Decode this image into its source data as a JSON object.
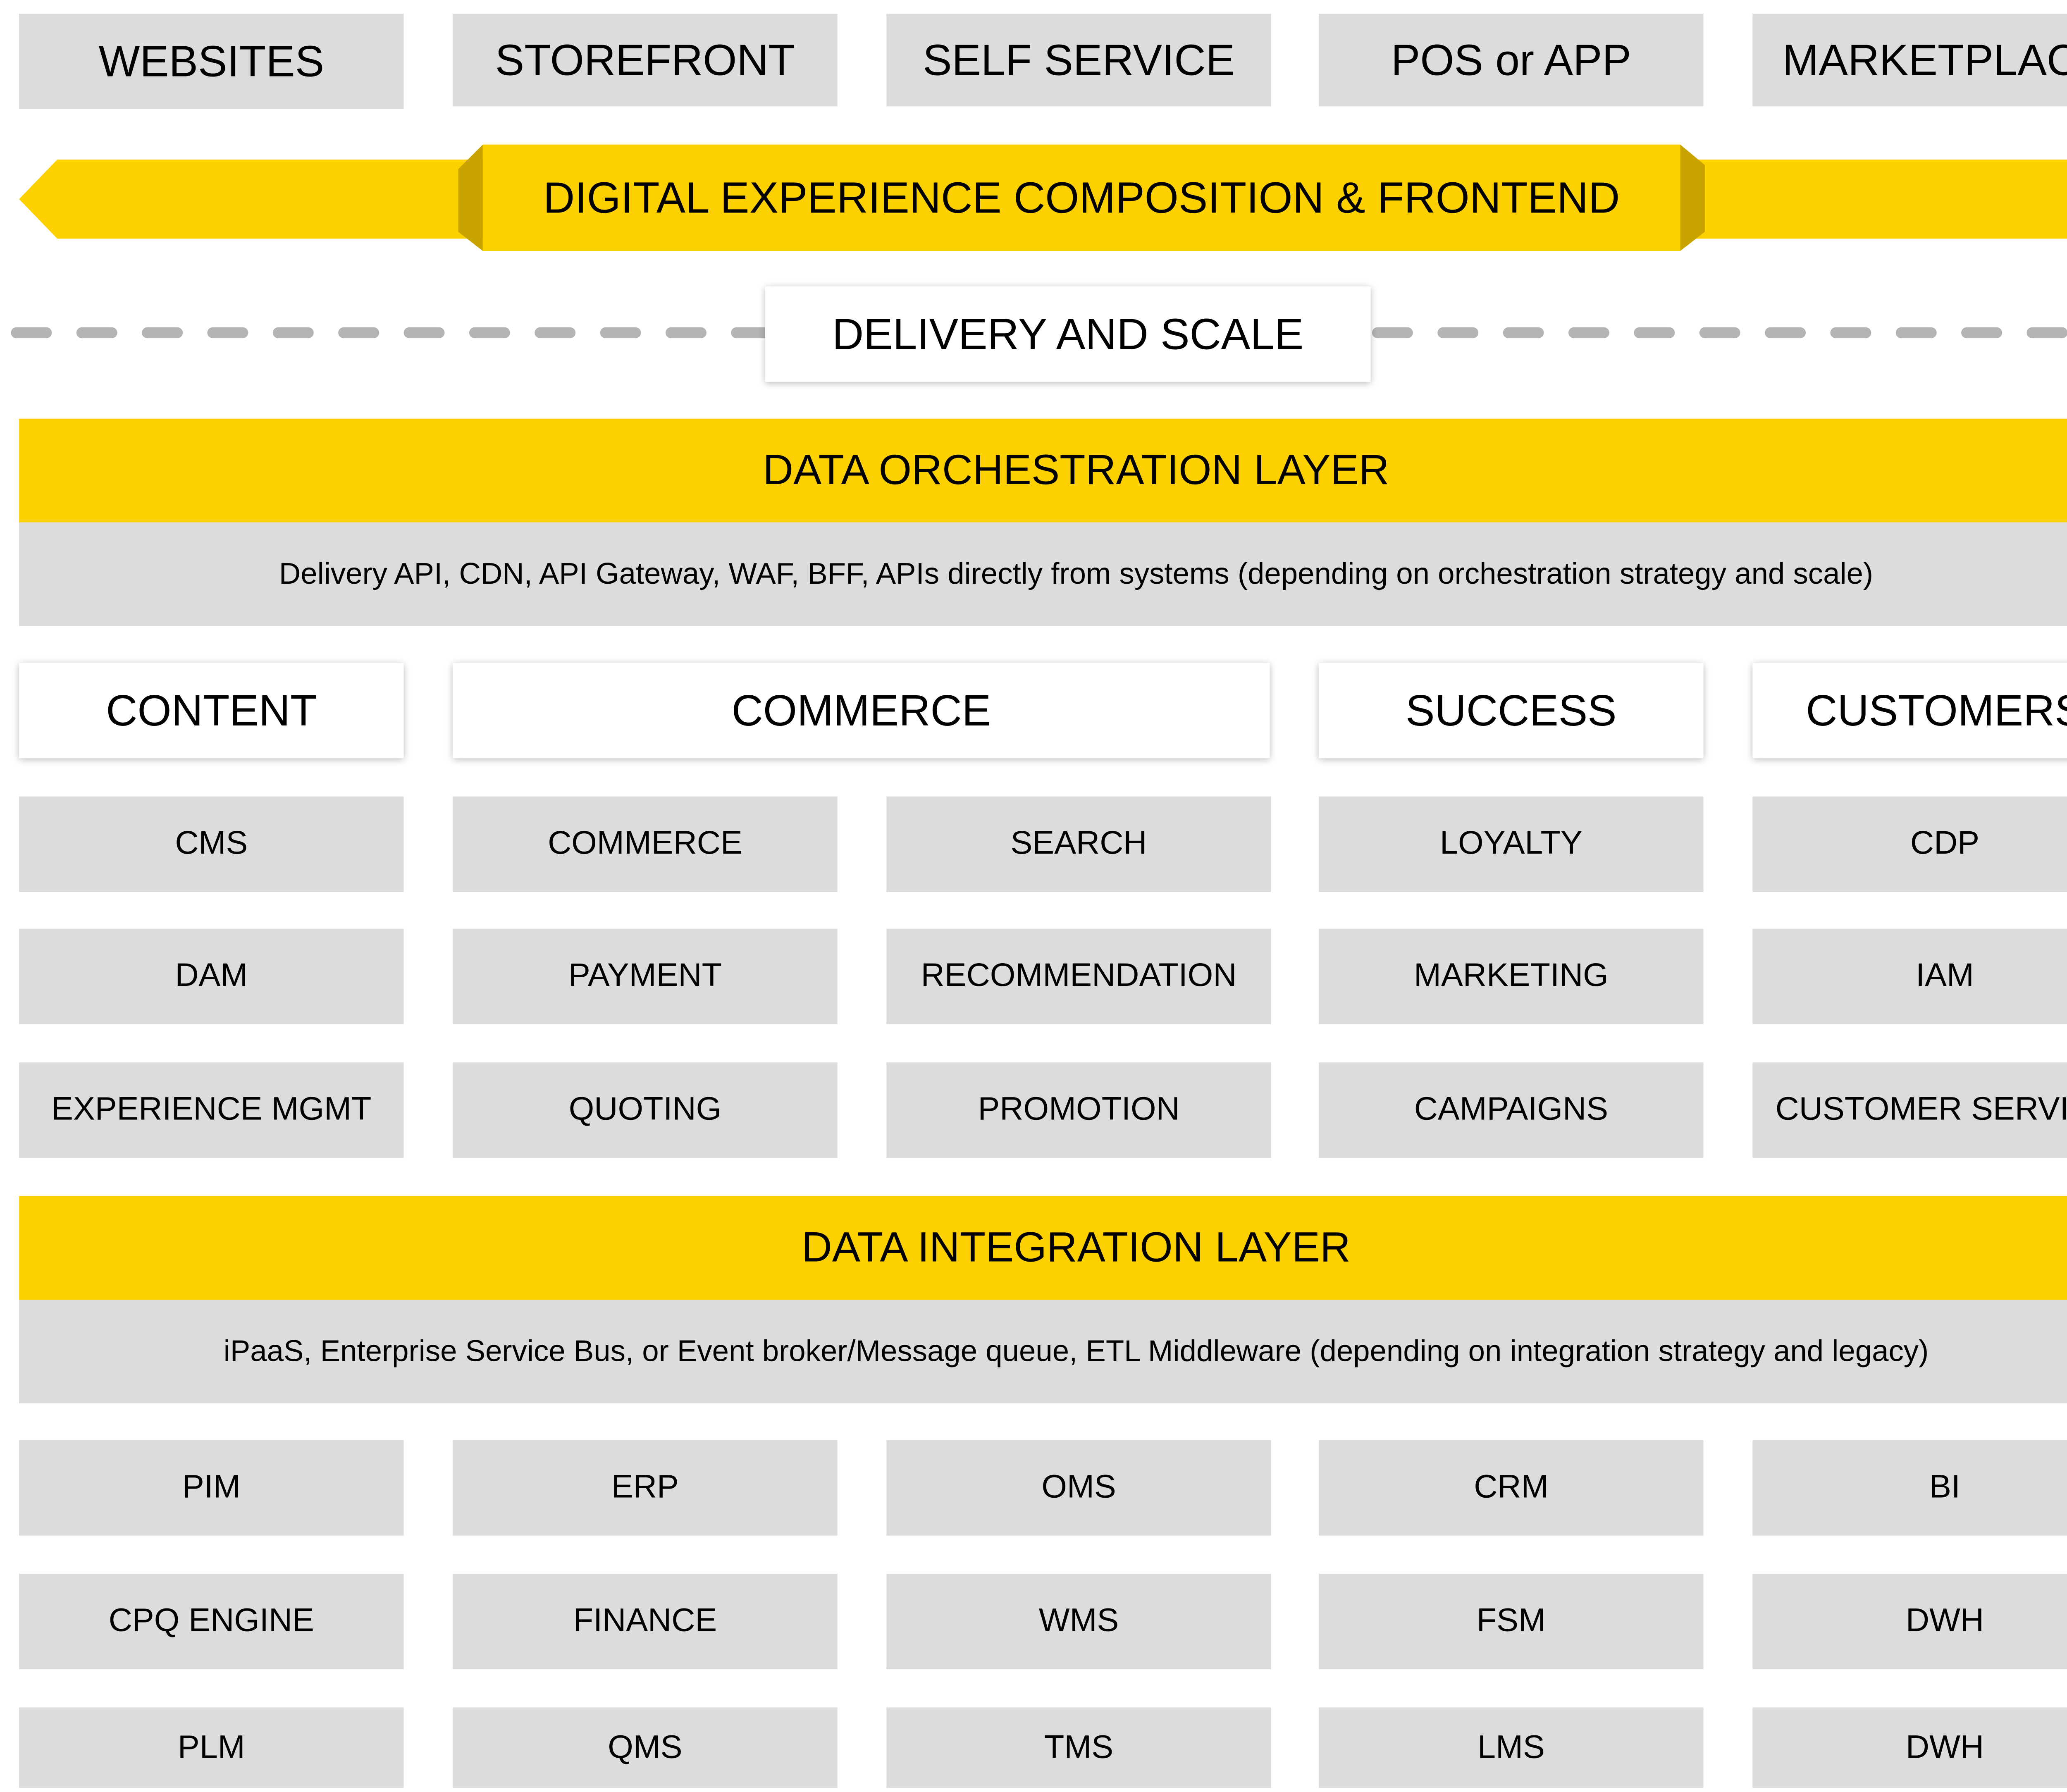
{
  "channels": [
    "WEBSITES",
    "STOREFRONT",
    "SELF SERVICE",
    "POS or APP",
    "MARKETPLACE"
  ],
  "experience_banner": "DIGITAL EXPERIENCE COMPOSITION & FRONTEND",
  "delivery_label": "DELIVERY AND SCALE",
  "orchestration": {
    "title": "DATA ORCHESTRATION LAYER",
    "description": "Delivery API, CDN, API Gateway, WAF, BFF, APIs directly from systems (depending on orchestration strategy and scale)"
  },
  "domains": [
    "CONTENT",
    "COMMERCE",
    "SUCCESS",
    "CUSTOMERS"
  ],
  "capabilities": [
    [
      "CMS",
      "COMMERCE",
      "SEARCH",
      "LOYALTY",
      "CDP"
    ],
    [
      "DAM",
      "PAYMENT",
      "RECOMMENDATION",
      "MARKETING",
      "IAM"
    ],
    [
      "EXPERIENCE MGMT",
      "QUOTING",
      "PROMOTION",
      "CAMPAIGNS",
      "CUSTOMER SERVICE"
    ]
  ],
  "integration": {
    "title": "DATA INTEGRATION LAYER",
    "description": "iPaaS, Enterprise Service Bus, or Event broker/Message queue, ETL Middleware (depending on integration strategy and legacy)"
  },
  "systems": [
    [
      "PIM",
      "ERP",
      "OMS",
      "CRM",
      "BI"
    ],
    [
      "CPQ ENGINE",
      "FINANCE",
      "WMS",
      "FSM",
      "DWH"
    ],
    [
      "PLM",
      "QMS",
      "TMS",
      "LMS",
      "DWH"
    ]
  ],
  "colors": {
    "accent": "#fdd000",
    "accent_dark": "#c9a400",
    "box": "#dcdcdc",
    "dash": "#b4b4b4"
  }
}
